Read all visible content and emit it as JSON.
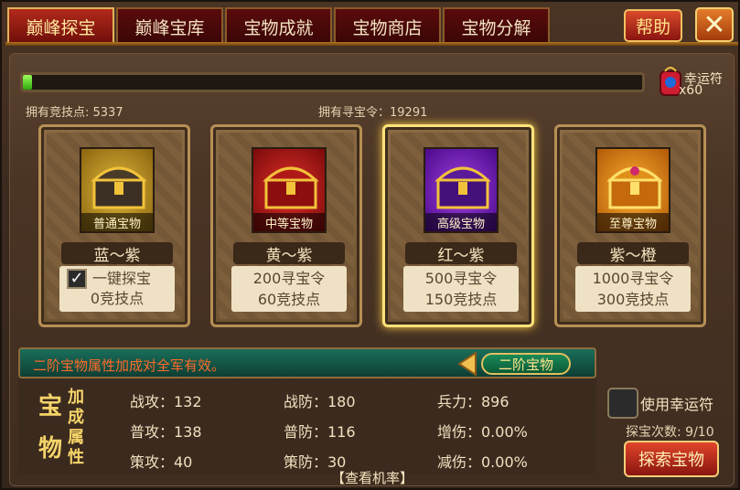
{
  "tabs": [
    "巅峰探宝",
    "巅峰宝库",
    "宝物成就",
    "宝物商店",
    "宝物分解"
  ],
  "help_label": "帮助",
  "close_label": "✕",
  "progress": {
    "fill_percent": 1.5
  },
  "luck_item": {
    "label": "幸运符",
    "count": "x60"
  },
  "stats": {
    "competitive_points": "拥有竞技点:  5337",
    "treasure_tokens": "拥有寻宝令：19291"
  },
  "cards": [
    {
      "chest_name": "普通宝物",
      "grade": "蓝～紫",
      "onekey": "一键探宝",
      "cost_line2": "0竞技点",
      "color": "#c99a22"
    },
    {
      "chest_name": "中等宝物",
      "grade": "黄～紫",
      "cost_line1": "200寻宝令",
      "cost_line2": "60竞技点",
      "color": "#c12020"
    },
    {
      "chest_name": "高级宝物",
      "grade": "红～紫",
      "cost_line1": "500寻宝令",
      "cost_line2": "150竞技点",
      "color": "#7a22c4"
    },
    {
      "chest_name": "至尊宝物",
      "grade": "紫～橙",
      "cost_line1": "1000寻宝令",
      "cost_line2": "300竞技点",
      "color": "#e08a18"
    }
  ],
  "attributes": {
    "notice": "二阶宝物属性加成对全军有效。",
    "level": "二阶宝物",
    "title_big": [
      "宝",
      "物"
    ],
    "title_small": [
      "加",
      "成",
      "属",
      "性"
    ],
    "rows": [
      [
        "战攻：132",
        "战防：180",
        "兵力：896"
      ],
      [
        "普攻：138",
        "普防：116",
        "增伤：0.00%"
      ],
      [
        "策攻：40",
        "策防：30",
        "减伤：0.00%"
      ]
    ],
    "view_rate": "【查看机率】"
  },
  "controls": {
    "use_luck": "使用幸运符",
    "search_count": "探宝次数: 9/10",
    "explore_button": "探索宝物"
  }
}
